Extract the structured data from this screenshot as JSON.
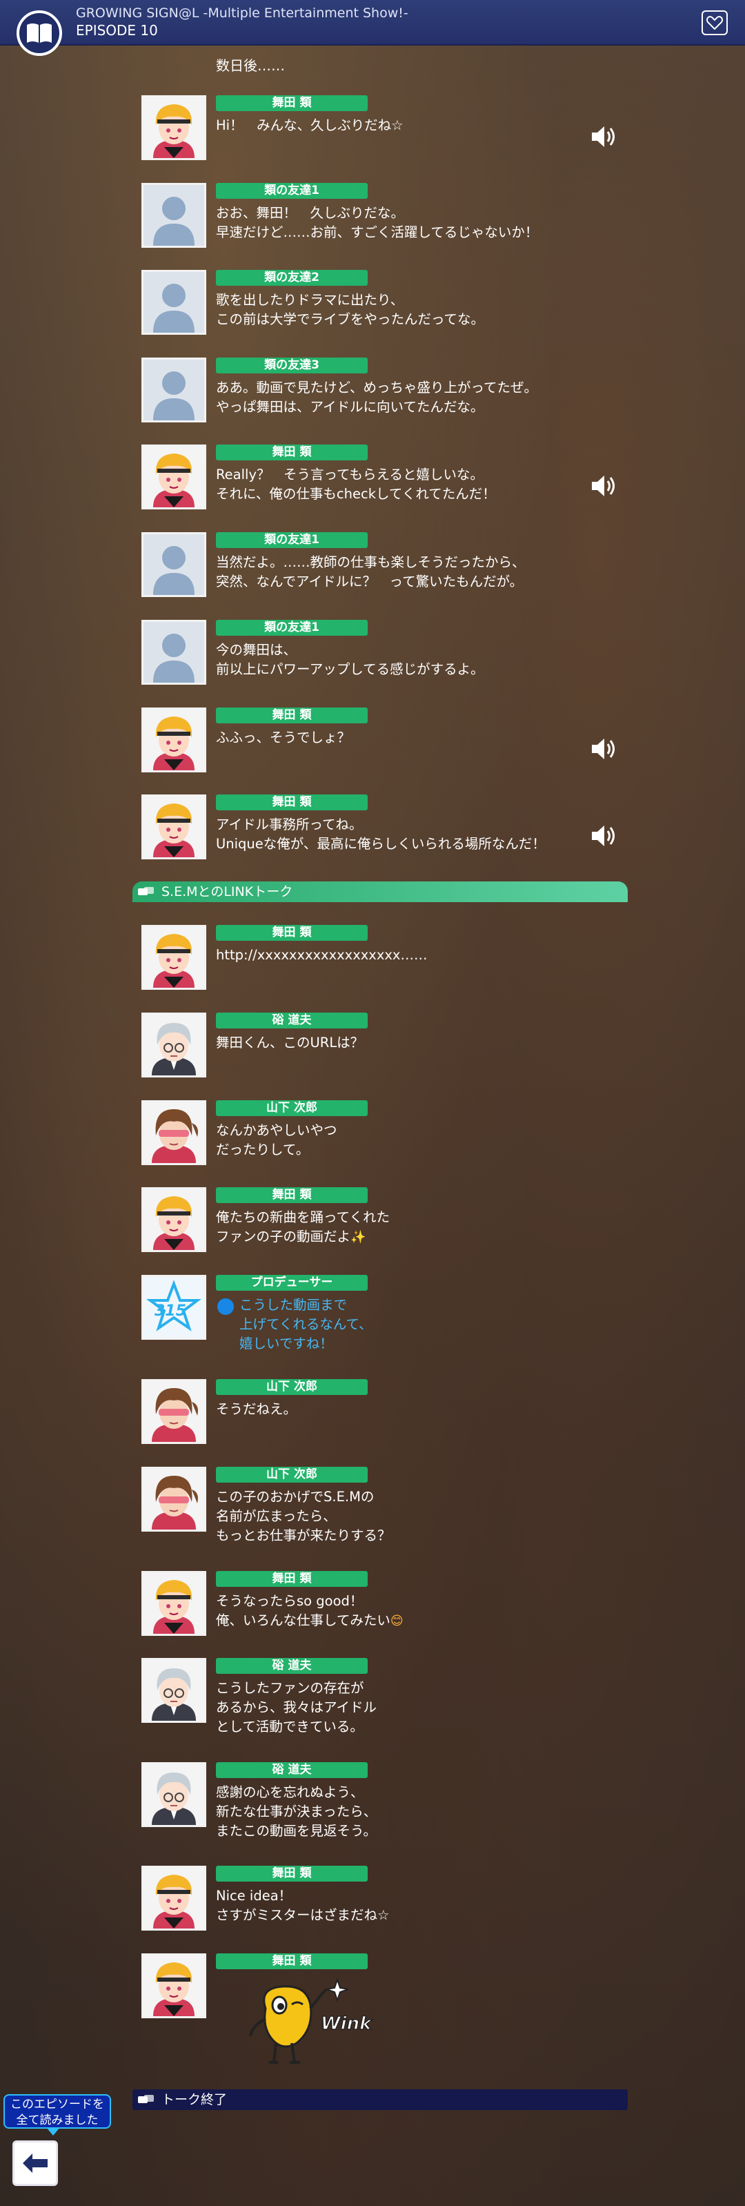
{
  "header": {
    "title": "GROWING SIGN@L -Multiple Entertainment Show!-",
    "episode": "EPISODE 10"
  },
  "narration": "数日後……",
  "messages": [
    {
      "name": "舞田 類",
      "text": "Hi！　みんな、久しぶりだね☆",
      "avatar": "rui",
      "voice": true
    },
    {
      "name": "類の友達1",
      "text": "おお、舞田！　久しぶりだな。\n早速だけど……お前、すごく活躍してるじゃないか！",
      "avatar": "silhouette",
      "voice": false
    },
    {
      "name": "類の友達2",
      "text": "歌を出したりドラマに出たり、\nこの前は大学でライブをやったんだってな。",
      "avatar": "silhouette",
      "voice": false
    },
    {
      "name": "類の友達3",
      "text": "ああ。動画で見たけど、めっちゃ盛り上がってたぜ。\nやっぱ舞田は、アイドルに向いてたんだな。",
      "avatar": "silhouette",
      "voice": false
    },
    {
      "name": "舞田 類",
      "text": "Really？　そう言ってもらえると嬉しいな。\nそれに、俺の仕事もcheckしてくれてたんだ！",
      "avatar": "rui",
      "voice": true
    },
    {
      "name": "類の友達1",
      "text": "当然だよ。……教師の仕事も楽しそうだったから、\n突然、なんでアイドルに？　って驚いたもんだが。",
      "avatar": "silhouette",
      "voice": false
    },
    {
      "name": "類の友達1",
      "text": "今の舞田は、\n前以上にパワーアップしてる感じがするよ。",
      "avatar": "silhouette",
      "voice": false
    },
    {
      "name": "舞田 類",
      "text": "ふふっ、そうでしょ？",
      "avatar": "rui",
      "voice": true
    },
    {
      "name": "舞田 類",
      "text": "アイドル事務所ってね。\nUniqueな俺が、最高に俺らしくいられる場所なんだ！",
      "avatar": "rui",
      "voice": true
    }
  ],
  "talk_header": "S.E.MとのLINKトーク",
  "talk_messages": [
    {
      "name": "舞田 類",
      "text": "http://xxxxxxxxxxxxxxxxxx……",
      "avatar": "rui"
    },
    {
      "name": "硲 道夫",
      "text": "舞田くん、このURLは？",
      "avatar": "michio"
    },
    {
      "name": "山下 次郎",
      "text": "なんかあやしいやつ\nだったりして。",
      "avatar": "jiro"
    },
    {
      "name": "舞田 類",
      "text": "俺たちの新曲を踊ってくれた\nファンの子の動画だよ",
      "emoji": "✨",
      "avatar": "rui"
    },
    {
      "name": "プロデューサー",
      "text": "こうした動画まで\n上げてくれるなんて、\n嬉しいですね！",
      "avatar": "producer"
    },
    {
      "name": "山下 次郎",
      "text": "そうだねえ。",
      "avatar": "jiro"
    },
    {
      "name": "山下 次郎",
      "text": "この子のおかげでS.E.Mの\n名前が広まったら、\nもっとお仕事が来たりする？",
      "avatar": "jiro"
    },
    {
      "name": "舞田 類",
      "text": "そうなったらso good！\n俺、いろんな仕事してみたい",
      "emoji": "😊",
      "avatar": "rui"
    },
    {
      "name": "硲 道夫",
      "text": "こうしたファンの存在が\nあるから、我々はアイドル\nとして活動できている。",
      "avatar": "michio"
    },
    {
      "name": "硲 道夫",
      "text": "感謝の心を忘れぬよう、\n新たな仕事が決まったら、\nまたこの動画を見返そう。",
      "avatar": "michio"
    },
    {
      "name": "舞田 類",
      "text": "Nice idea！\nさすがミスターはざまだね☆",
      "avatar": "rui"
    },
    {
      "name": "舞田 類",
      "text": "",
      "sticker": "Wink",
      "avatar": "rui"
    }
  ],
  "talk_end": "トーク終了",
  "finish_tip": "このエピソードを\n全て読みました",
  "icons": {
    "logo": "book-icon",
    "favorite": "heart-icon",
    "voice": "speaker-icon",
    "back": "back-arrow-icon"
  },
  "colors": {
    "header": "#2f3e78",
    "name_tag": "#23b36b",
    "talk_start": "#28a86a",
    "talk_end": "#15184c",
    "producer_text": "#47b7f3"
  }
}
